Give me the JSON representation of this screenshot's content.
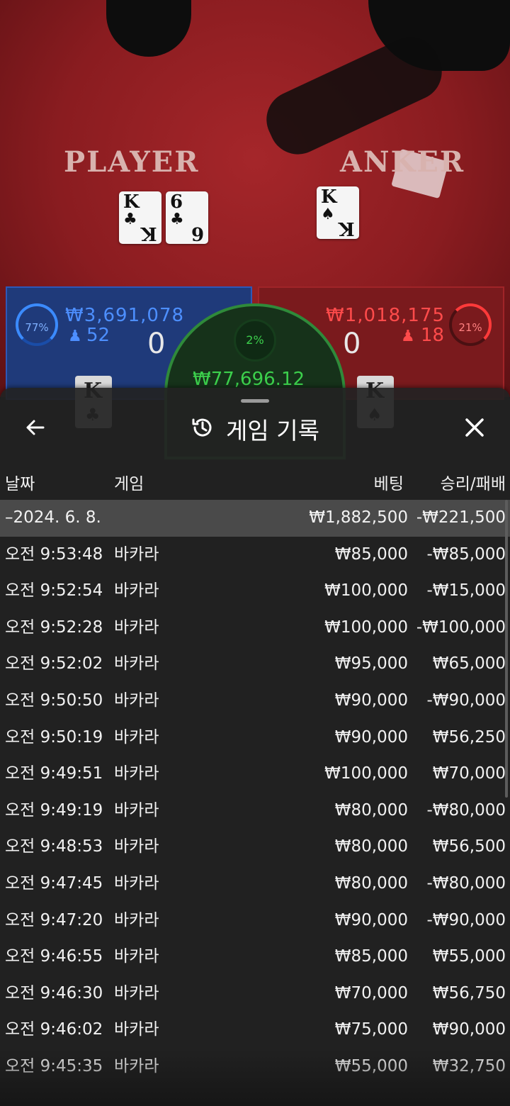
{
  "scene": {
    "player_label": "PLAYER",
    "banker_label": "ANKER",
    "player_cards": [
      {
        "rank": "K",
        "suit": "♣"
      },
      {
        "rank": "6",
        "suit": "♣"
      }
    ],
    "banker_cards": [
      {
        "rank": "K",
        "suit": "♠"
      }
    ],
    "player_panel": {
      "percent": "77%",
      "amount": "₩3,691,078",
      "count": "52",
      "score": "0"
    },
    "banker_panel": {
      "percent": "21%",
      "amount": "₩1,018,175",
      "count": "18",
      "score": "0"
    },
    "tie_panel": {
      "percent": "2%",
      "amount": "₩77,696.12"
    },
    "player_mini_card": {
      "rank": "K",
      "suit": "♣"
    },
    "banker_mini_card": {
      "rank": "K",
      "suit": "♠"
    },
    "colors": {
      "player": "#1f3a7a",
      "banker": "#7a1a1d",
      "tie": "#3cd04c"
    }
  },
  "sheet": {
    "title": "게임 기록",
    "history_icon": "history-icon",
    "back_icon": "arrow-left-icon",
    "close_icon": "close-icon",
    "columns": {
      "date": "날짜",
      "game": "게임",
      "bet": "베팅",
      "result": "승리/패배"
    },
    "date_row": {
      "date": "–2024. 6. 8.",
      "bet": "₩1,882,500",
      "result": "-₩221,500"
    },
    "rows": [
      {
        "time": "오전 9:53:48",
        "game": "바카라",
        "bet": "₩85,000",
        "result": "-₩85,000"
      },
      {
        "time": "오전 9:52:54",
        "game": "바카라",
        "bet": "₩100,000",
        "result": "-₩15,000"
      },
      {
        "time": "오전 9:52:28",
        "game": "바카라",
        "bet": "₩100,000",
        "result": "-₩100,000"
      },
      {
        "time": "오전 9:52:02",
        "game": "바카라",
        "bet": "₩95,000",
        "result": "₩65,000"
      },
      {
        "time": "오전 9:50:50",
        "game": "바카라",
        "bet": "₩90,000",
        "result": "-₩90,000"
      },
      {
        "time": "오전 9:50:19",
        "game": "바카라",
        "bet": "₩90,000",
        "result": "₩56,250"
      },
      {
        "time": "오전 9:49:51",
        "game": "바카라",
        "bet": "₩100,000",
        "result": "₩70,000"
      },
      {
        "time": "오전 9:49:19",
        "game": "바카라",
        "bet": "₩80,000",
        "result": "-₩80,000"
      },
      {
        "time": "오전 9:48:53",
        "game": "바카라",
        "bet": "₩80,000",
        "result": "₩56,500"
      },
      {
        "time": "오전 9:47:45",
        "game": "바카라",
        "bet": "₩80,000",
        "result": "-₩80,000"
      },
      {
        "time": "오전 9:47:20",
        "game": "바카라",
        "bet": "₩90,000",
        "result": "-₩90,000"
      },
      {
        "time": "오전 9:46:55",
        "game": "바카라",
        "bet": "₩85,000",
        "result": "₩55,000"
      },
      {
        "time": "오전 9:46:30",
        "game": "바카라",
        "bet": "₩70,000",
        "result": "₩56,750"
      },
      {
        "time": "오전 9:46:02",
        "game": "바카라",
        "bet": "₩75,000",
        "result": "₩90,000"
      },
      {
        "time": "오전 9:45:35",
        "game": "바카라",
        "bet": "₩55,000",
        "result": "₩32,750"
      }
    ]
  }
}
